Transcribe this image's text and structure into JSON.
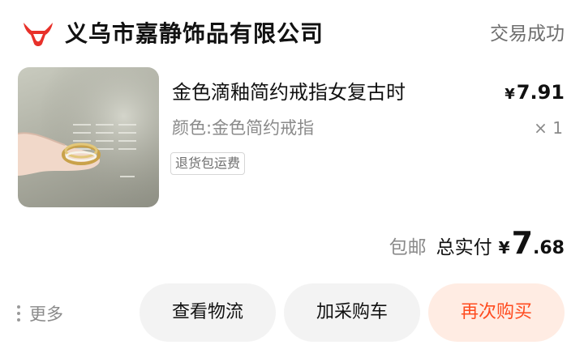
{
  "shop": {
    "name": "义乌市嘉静饰品有限公司",
    "logo_icon": "bull-logo-icon",
    "logo_color": "#e8312a"
  },
  "order": {
    "status": "交易成功"
  },
  "product": {
    "title": "金色滴釉简约戒指女复古时",
    "spec": "颜色:金色简约戒指",
    "badge": "退货包运费",
    "price_currency": "¥",
    "price_value": "7.91",
    "quantity": "× 1"
  },
  "total": {
    "shipping": "包邮",
    "label": "总实付",
    "currency": "¥",
    "amount_int": "7",
    "amount_dec": ".68"
  },
  "actions": {
    "more_label": "更多",
    "logistics_label": "查看物流",
    "add_cart_label": "加采购车",
    "rebuy_label": "再次购买"
  },
  "colors": {
    "accent": "#ff4b1f",
    "accent_bg": "#ffece3",
    "button_bg": "#f3f3f3"
  }
}
